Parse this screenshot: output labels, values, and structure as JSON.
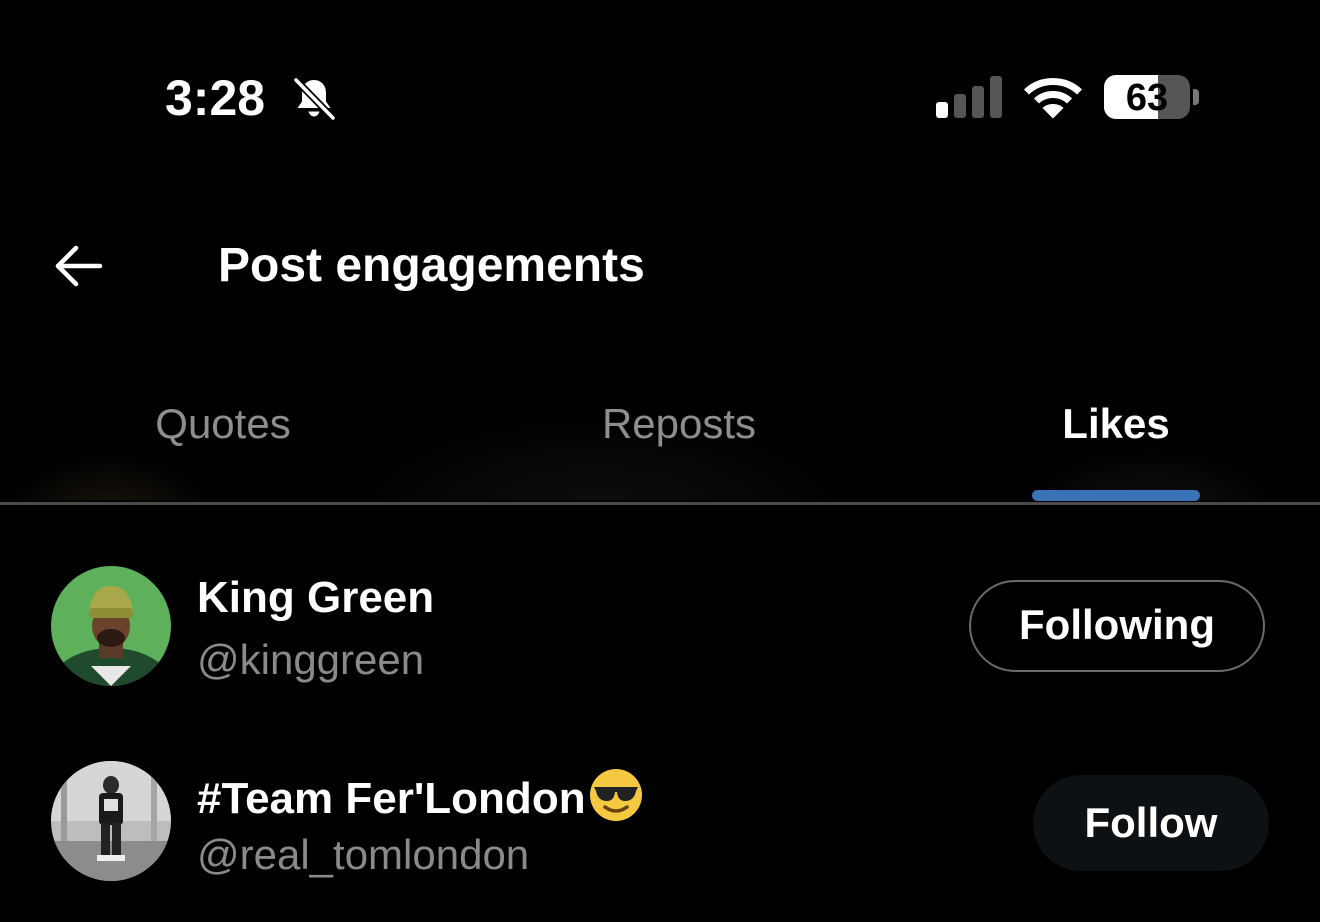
{
  "status_bar": {
    "time": "3:28",
    "battery_percent": "63",
    "battery_level": 0.63,
    "icons": [
      "bell-slash-icon",
      "cellular-signal-icon",
      "wifi-icon",
      "battery-icon"
    ],
    "signal_bars_active": 1,
    "signal_bars_total": 4
  },
  "header": {
    "back_icon": "arrow-left-icon",
    "title": "Post engagements"
  },
  "tabs": [
    {
      "label": "Quotes",
      "active": false
    },
    {
      "label": "Reposts",
      "active": false
    },
    {
      "label": "Likes",
      "active": true
    }
  ],
  "colors": {
    "background": "#000000",
    "tab_indicator": "#3a72b8",
    "muted_text": "#8a8a8a"
  },
  "users": [
    {
      "name": "King Green",
      "handle": "@kinggreen",
      "button": "Following",
      "avatar": "photo-green-background"
    },
    {
      "name": "#Team Fer'London",
      "name_emoji": "smiling-face-with-sunglasses-emoji",
      "handle": "@real_tomlondon",
      "button": "Follow",
      "avatar": "photo-grayscale"
    }
  ]
}
